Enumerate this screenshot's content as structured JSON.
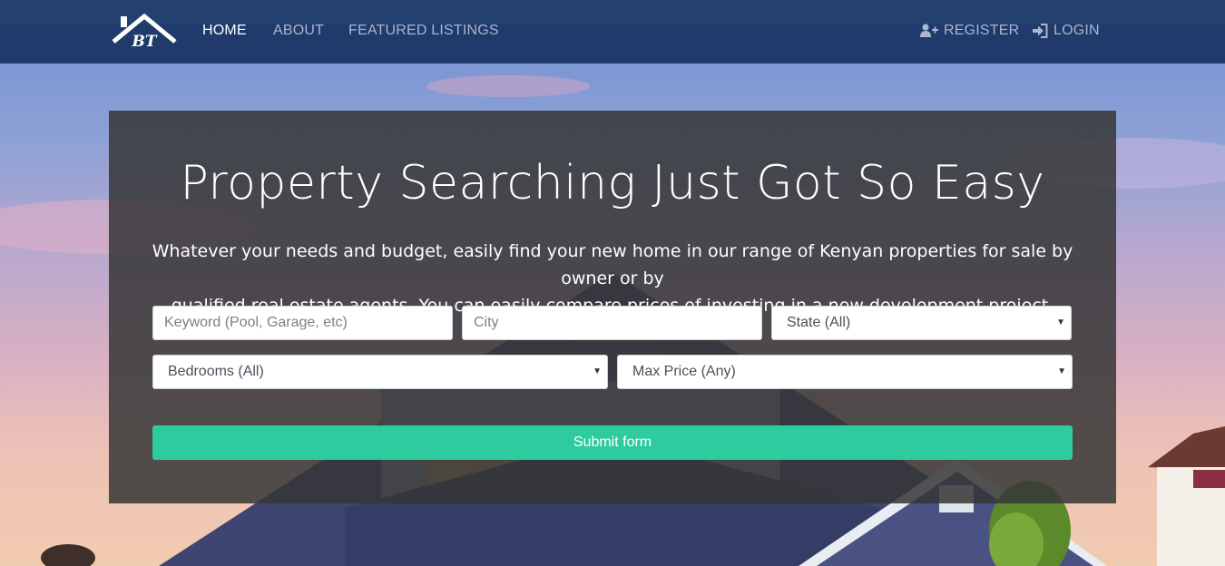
{
  "nav": {
    "brand_initials": "BT",
    "links": [
      {
        "label": "HOME",
        "active": true
      },
      {
        "label": "ABOUT",
        "active": false
      },
      {
        "label": "FEATURED LISTINGS",
        "active": false
      }
    ],
    "register_label": "REGISTER",
    "register_icon": "user-plus-icon",
    "login_label": "LOGIN",
    "login_icon": "sign-in-icon"
  },
  "hero": {
    "title": "Property Searching Just Got So Easy",
    "lead_line1": "Whatever your needs and budget, easily find your new home in our range of Kenyan properties for sale by owner or by",
    "lead_line2": "qualified real estate agents. You can easily compare prices of investing in a new development project."
  },
  "search_form": {
    "keyword_placeholder": "Keyword (Pool, Garage, etc)",
    "city_placeholder": "City",
    "state_selected": "State (All)",
    "bedrooms_selected": "Bedrooms (All)",
    "max_price_selected": "Max Price (Any)",
    "submit_label": "Submit form"
  },
  "colors": {
    "navbar": "#1f3a6b",
    "accent": "#2ecb9f",
    "panel": "#373737"
  }
}
